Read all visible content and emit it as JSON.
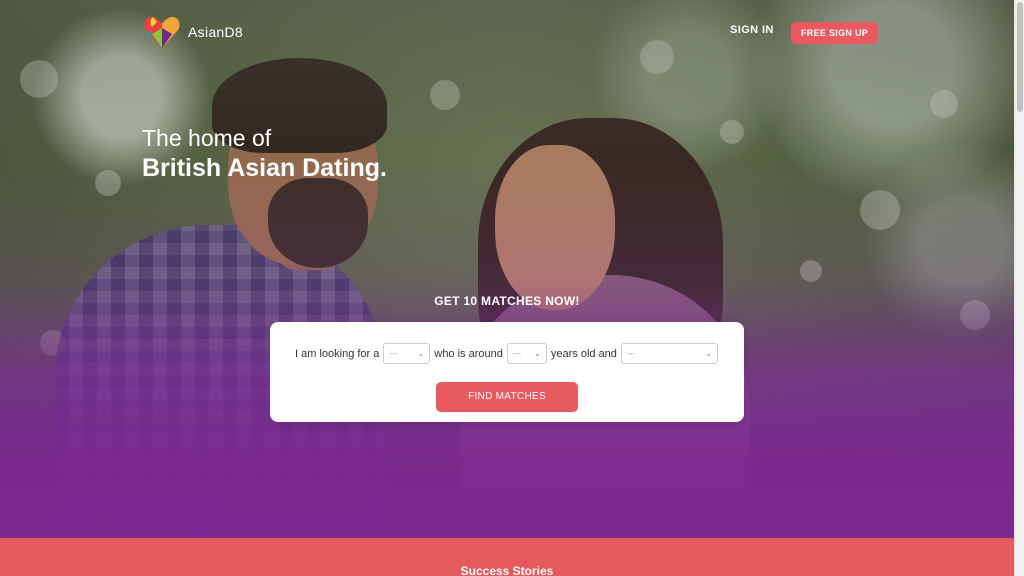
{
  "header": {
    "brand_name": "AsianD8",
    "sign_in_label": "SIGN IN",
    "sign_up_label": "FREE SIGN UP"
  },
  "hero": {
    "headline_line1": "The home of",
    "headline_line2": "British Asian Dating."
  },
  "search": {
    "cta": "GET 10 MATCHES NOW!",
    "label_looking_for": "I am looking for a",
    "label_age": "who is around",
    "label_years": "years old and",
    "select_gender_value": "---",
    "select_age_value": "---",
    "select_other_value": "---",
    "button_label": "FIND MATCHES"
  },
  "footer_section": {
    "title": "Success Stories"
  },
  "colors": {
    "accent": "#e85a5f",
    "hero_overlay": "#7b2a92",
    "stories_band": "#e45a5d"
  }
}
